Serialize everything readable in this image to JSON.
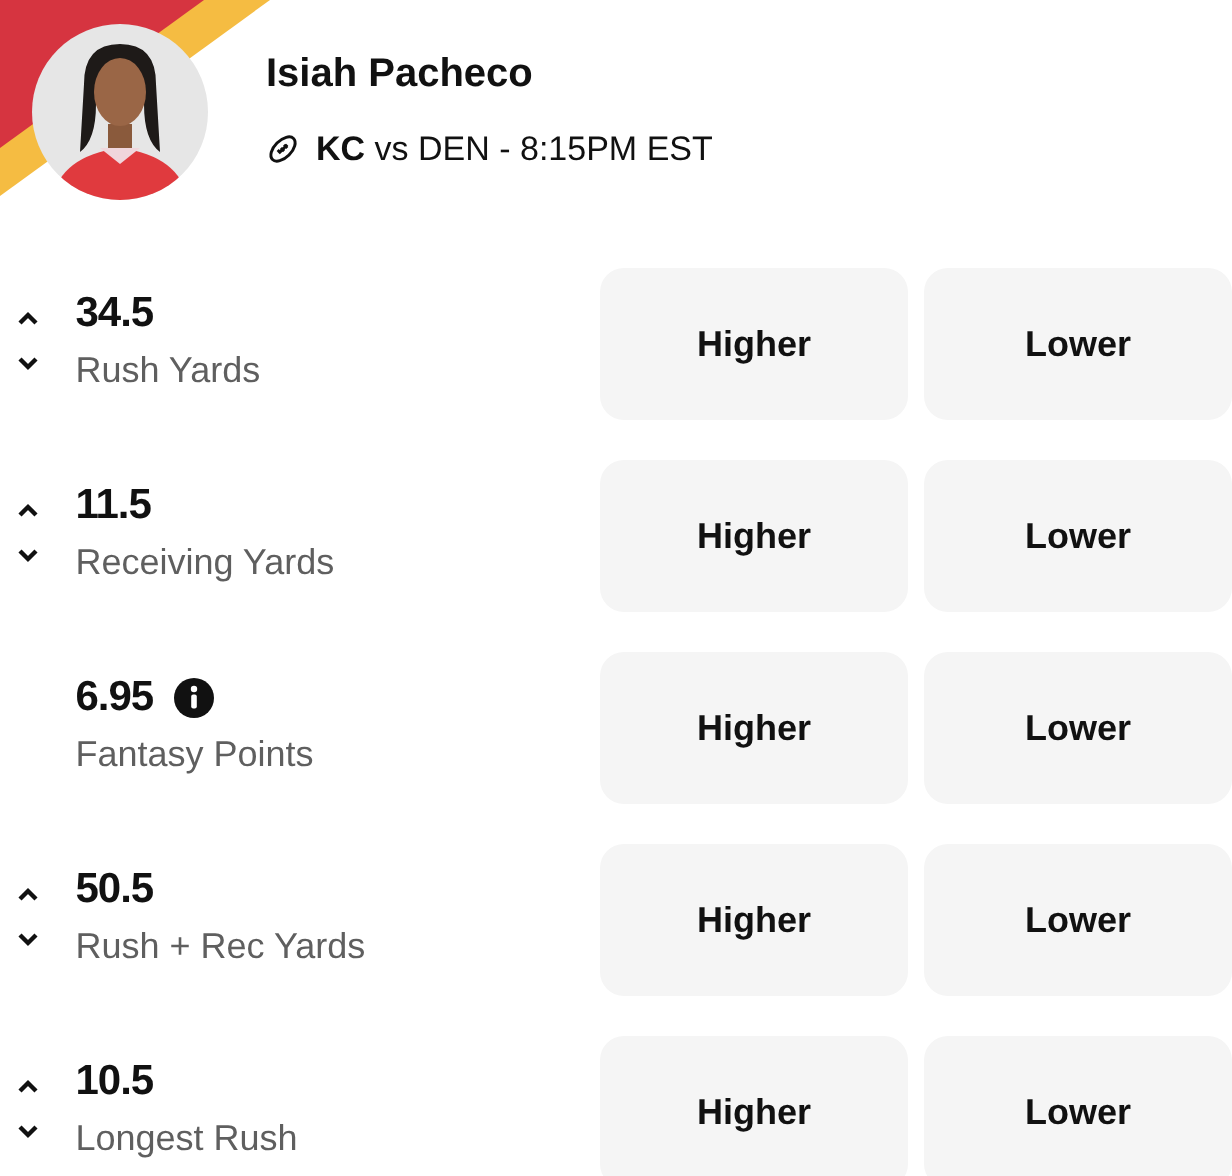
{
  "player": {
    "name": "Isiah Pacheco",
    "matchup": "**KC** vs DEN - 8:15PM EST"
  },
  "props": [
    {
      "kind": "adjustable",
      "line": "34.5",
      "stat": "Rush Yards",
      "higher": "Higher",
      "lower": "Lower"
    },
    {
      "kind": "adjustable",
      "line": "11.5",
      "stat": "Receiving Yards",
      "higher": "Higher",
      "lower": "Lower"
    },
    {
      "kind": "info",
      "line": "6.95",
      "stat": "Fantasy Points",
      "higher": "Higher",
      "lower": "Lower"
    },
    {
      "kind": "adjustable",
      "line": "50.5",
      "stat": "Rush + Rec Yards",
      "higher": "Higher",
      "lower": "Lower"
    },
    {
      "kind": "adjustable",
      "line": "10.5",
      "stat": "Longest Rush",
      "higher": "Higher",
      "lower": "Lower"
    }
  ]
}
